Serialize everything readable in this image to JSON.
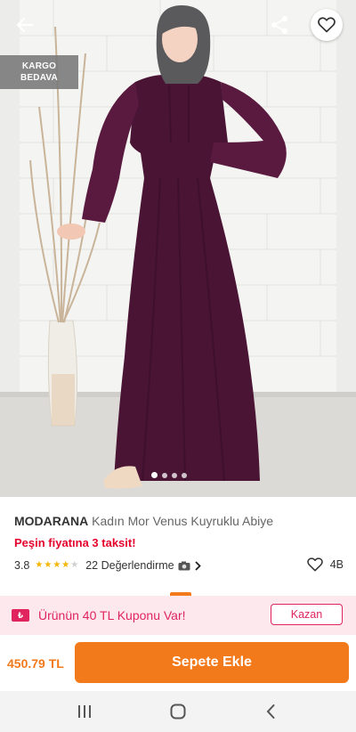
{
  "product": {
    "brand": "MODARANA",
    "name": "Kadın Mor Venus Kuyruklu Abiye",
    "installment_text": "Peşin fiyatına 3 taksit!",
    "rating": "3.8",
    "rating_stars": 4,
    "reviews_text": "22 Değerlendirme",
    "favorite_count": "4B",
    "price": "450.79 TL"
  },
  "image": {
    "badge_line1": "KARGO",
    "badge_line2": "BEDAVA",
    "carousel_count": 4,
    "carousel_active": 1
  },
  "coupon": {
    "text": "Ürünün 40 TL Kuponu Var!",
    "button_label": "Kazan",
    "icon_text": "₺"
  },
  "actions": {
    "add_to_cart_label": "Sepete Ekle"
  },
  "icons": {
    "back": "back-arrow-icon",
    "share": "share-icon",
    "favorite": "heart-icon",
    "camera": "camera-icon",
    "chevron": "chevron-right-icon",
    "nav_recent": "recent-apps-icon",
    "nav_home": "home-icon",
    "nav_back": "back-icon"
  },
  "colors": {
    "accent": "#f27a1a",
    "alert": "#e5002b",
    "coupon": "#e0245e",
    "star": "#f5b400",
    "dress": "#4a1434"
  }
}
